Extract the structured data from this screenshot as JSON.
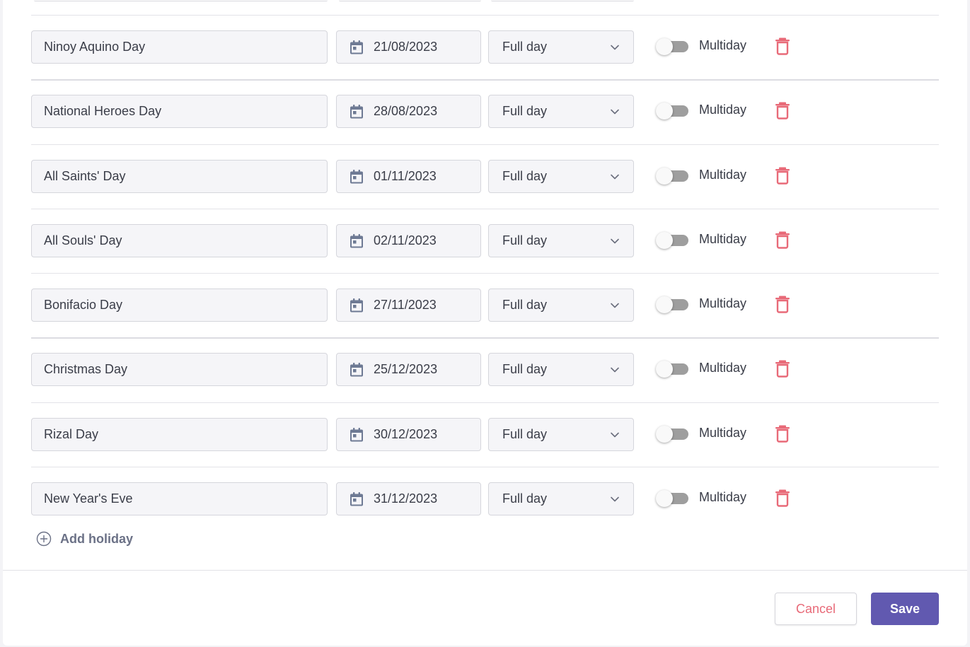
{
  "colors": {
    "accent": "#6159b0",
    "danger": "#e86a78",
    "icon": "#6e7a94",
    "field_bg": "#f5f5f8"
  },
  "icons": {
    "date": "calendar-icon",
    "type_dropdown": "chevron-down-icon",
    "delete": "trash-icon",
    "add": "plus-circle-icon"
  },
  "holidays": [
    {
      "name": "Ninoy Aquino Day",
      "date": "21/08/2023",
      "type": "Full day",
      "multiday_label": "Multiday",
      "multiday": false
    },
    {
      "name": "National Heroes Day",
      "date": "28/08/2023",
      "type": "Full day",
      "multiday_label": "Multiday",
      "multiday": false
    },
    {
      "name": "All Saints' Day",
      "date": "01/11/2023",
      "type": "Full day",
      "multiday_label": "Multiday",
      "multiday": false
    },
    {
      "name": "All Souls' Day",
      "date": "02/11/2023",
      "type": "Full day",
      "multiday_label": "Multiday",
      "multiday": false
    },
    {
      "name": "Bonifacio Day",
      "date": "27/11/2023",
      "type": "Full day",
      "multiday_label": "Multiday",
      "multiday": false
    },
    {
      "name": "Christmas Day",
      "date": "25/12/2023",
      "type": "Full day",
      "multiday_label": "Multiday",
      "multiday": false
    },
    {
      "name": "Rizal Day",
      "date": "30/12/2023",
      "type": "Full day",
      "multiday_label": "Multiday",
      "multiday": false
    },
    {
      "name": "New Year's Eve",
      "date": "31/12/2023",
      "type": "Full day",
      "multiday_label": "Multiday",
      "multiday": false
    }
  ],
  "actions": {
    "add_holiday_label": "Add holiday",
    "cancel_label": "Cancel",
    "save_label": "Save"
  }
}
